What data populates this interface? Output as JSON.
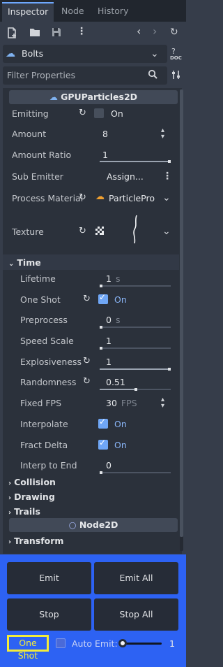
{
  "tabs": [
    {
      "label": "Inspector"
    },
    {
      "label": "Node"
    },
    {
      "label": "History"
    }
  ],
  "object": {
    "name": "Bolts",
    "doc_label": "DOC"
  },
  "filter": {
    "placeholder": "Filter Properties"
  },
  "sections": {
    "gpu": "GPUParticles2D",
    "node2d": "Node2D"
  },
  "props": {
    "emitting": {
      "label": "Emitting",
      "value": "On",
      "checked": false
    },
    "amount": {
      "label": "Amount",
      "value": "8"
    },
    "amount_ratio": {
      "label": "Amount Ratio",
      "value": "1",
      "fraction": 1.0
    },
    "sub_emitter": {
      "label": "Sub Emitter",
      "value": "Assign..."
    },
    "process_material": {
      "label": "Process Material",
      "value": "ParticlePro"
    },
    "texture": {
      "label": "Texture"
    }
  },
  "time": {
    "label": "Time",
    "lifetime": {
      "label": "Lifetime",
      "value": "1",
      "unit": "s"
    },
    "one_shot": {
      "label": "One Shot",
      "value": "On",
      "checked": true
    },
    "preprocess": {
      "label": "Preprocess",
      "value": "0",
      "unit": "s"
    },
    "speed_scale": {
      "label": "Speed Scale",
      "value": "1"
    },
    "explosiveness": {
      "label": "Explosiveness",
      "value": "1",
      "fraction": 1.0
    },
    "randomness": {
      "label": "Randomness",
      "value": "0.51",
      "fraction": 0.51
    },
    "fixed_fps": {
      "label": "Fixed FPS",
      "value": "30",
      "unit": "FPS"
    },
    "interpolate": {
      "label": "Interpolate",
      "value": "On",
      "checked": true
    },
    "fract_delta": {
      "label": "Fract Delta",
      "value": "On",
      "checked": true
    },
    "interp_to_end": {
      "label": "Interp to End",
      "value": "0",
      "fraction": 0.0
    }
  },
  "groups": [
    "Collision",
    "Drawing",
    "Trails",
    "Transform"
  ],
  "bottom": {
    "emit": "Emit",
    "emit_all": "Emit All",
    "stop": "Stop",
    "stop_all": "Stop All",
    "one_shot": "One Shot",
    "auto_emit": "Auto Emit:",
    "auto_emit_value": "1",
    "auto_emit_fraction": 0.0
  },
  "colors": {
    "accent": "#6fa6f5",
    "highlight_panel": "#2d62f3",
    "highlight_box": "#f3ec3a"
  }
}
